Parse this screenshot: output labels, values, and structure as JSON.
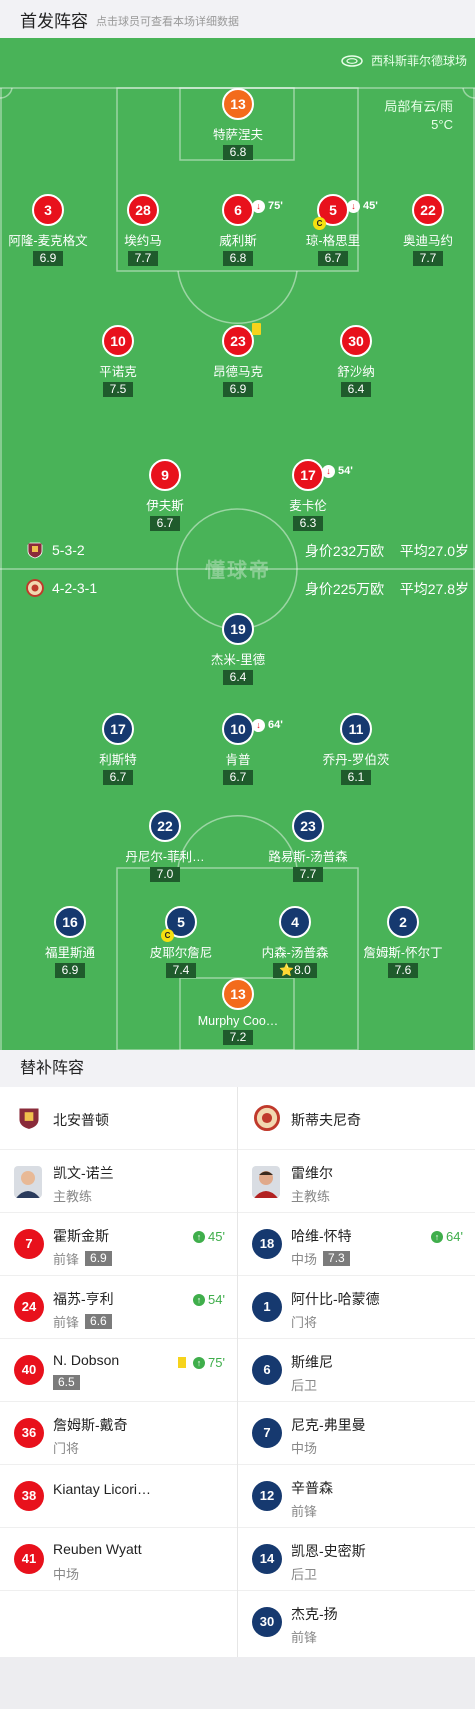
{
  "header": {
    "title": "首发阵容",
    "hint": "点击球员可查看本场详细数据"
  },
  "pitch": {
    "stadium": "西科斯菲尔德球场",
    "weather": "局部有云/雨",
    "temperature": "5°C",
    "watermark": "懂球帝"
  },
  "home_team": {
    "formation": "5-3-2",
    "value": "身价232万欧",
    "avg_age": "平均27.0岁",
    "color": "#e8111c",
    "players": [
      {
        "num": "13",
        "name": "特萨涅夫",
        "rating": "6.8"
      },
      {
        "num": "3",
        "name": "阿隆-麦克格文",
        "rating": "6.9"
      },
      {
        "num": "28",
        "name": "埃约马",
        "rating": "7.7"
      },
      {
        "num": "6",
        "name": "威利斯",
        "rating": "6.8",
        "sub_min": "75'"
      },
      {
        "num": "5",
        "name": "琼-格思里",
        "rating": "6.7",
        "sub_min": "45'",
        "captain": "C"
      },
      {
        "num": "22",
        "name": "奥迪马约",
        "rating": "7.7"
      },
      {
        "num": "10",
        "name": "平诺克",
        "rating": "7.5"
      },
      {
        "num": "23",
        "name": "昂德马克",
        "rating": "6.9"
      },
      {
        "num": "30",
        "name": "舒沙纳",
        "rating": "6.4"
      },
      {
        "num": "9",
        "name": "伊夫斯",
        "rating": "6.7"
      },
      {
        "num": "17",
        "name": "麦卡伦",
        "rating": "6.3",
        "sub_min": "54'"
      }
    ]
  },
  "away_team": {
    "formation": "4-2-3-1",
    "value": "身价225万欧",
    "avg_age": "平均27.8岁",
    "color": "#16396f",
    "players": [
      {
        "num": "19",
        "name": "杰米-里德",
        "rating": "6.4"
      },
      {
        "num": "17",
        "name": "利斯特",
        "rating": "6.7"
      },
      {
        "num": "10",
        "name": "肯普",
        "rating": "6.7",
        "sub_min": "64'"
      },
      {
        "num": "11",
        "name": "乔丹-罗伯茨",
        "rating": "6.1"
      },
      {
        "num": "22",
        "name": "丹尼尔-菲利…",
        "rating": "7.0"
      },
      {
        "num": "23",
        "name": "路易斯-汤普森",
        "rating": "7.7"
      },
      {
        "num": "16",
        "name": "福里斯通",
        "rating": "6.9"
      },
      {
        "num": "5",
        "name": "皮耶尔詹尼",
        "rating": "7.4",
        "captain": "C"
      },
      {
        "num": "4",
        "name": "内森-汤普森",
        "rating": "8.0",
        "star": "⭐"
      },
      {
        "num": "2",
        "name": "詹姆斯-怀尔丁",
        "rating": "7.6"
      },
      {
        "num": "13",
        "name": "Murphy Coo…",
        "rating": "7.2"
      }
    ]
  },
  "subs": {
    "title": "替补阵容",
    "left": {
      "team": "北安普顿",
      "coach": {
        "name": "凯文-诺兰",
        "role": "主教练"
      },
      "players": [
        {
          "num": "7",
          "name": "霍斯金斯",
          "pos": "前锋",
          "rating": "6.9",
          "event": "45'"
        },
        {
          "num": "24",
          "name": "福苏-亨利",
          "pos": "前锋",
          "rating": "6.6",
          "event": "54'"
        },
        {
          "num": "40",
          "name": "N. Dobson",
          "pos": "",
          "rating": "6.5",
          "event": "75'",
          "yellow": true
        },
        {
          "num": "36",
          "name": "詹姆斯-戴奇",
          "pos": "门将"
        },
        {
          "num": "38",
          "name": "Kiantay Licori…",
          "pos": ""
        },
        {
          "num": "41",
          "name": "Reuben Wyatt",
          "pos": "中场"
        }
      ]
    },
    "right": {
      "team": "斯蒂夫尼奇",
      "coach": {
        "name": "雷维尔",
        "role": "主教练"
      },
      "players": [
        {
          "num": "18",
          "name": "哈维-怀特",
          "pos": "中场",
          "rating": "7.3",
          "event": "64'"
        },
        {
          "num": "1",
          "name": "阿什比-哈蒙德",
          "pos": "门将"
        },
        {
          "num": "6",
          "name": "斯维尼",
          "pos": "后卫"
        },
        {
          "num": "7",
          "name": "尼克-弗里曼",
          "pos": "中场"
        },
        {
          "num": "12",
          "name": "辛普森",
          "pos": "前锋"
        },
        {
          "num": "14",
          "name": "凯恩-史密斯",
          "pos": "后卫"
        },
        {
          "num": "30",
          "name": "杰克-扬",
          "pos": "前锋"
        }
      ]
    }
  }
}
